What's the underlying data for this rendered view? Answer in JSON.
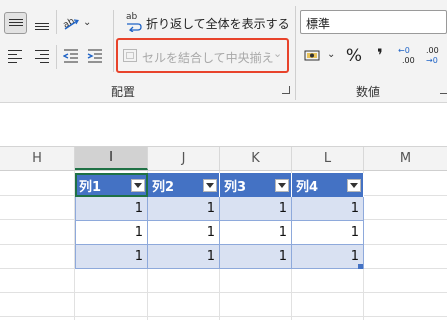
{
  "ribbon": {
    "wrap_text_label": "折り返して全体を表示する",
    "merge_center_label": "セルを結合して中央揃え",
    "merge_center_arrow": "⌄",
    "group_alignment_label": "配置",
    "number_format_value": "標準",
    "group_number_label": "数値",
    "percent_symbol": "%",
    "comma_symbol": "❜",
    "dec_increase_top": "←0",
    "dec_increase_bottom": ".00",
    "dec_decrease_top": ".00",
    "dec_decrease_bottom": "→0",
    "wrap_icon_text": "ab",
    "highlight_color": "#e8432b"
  },
  "columns": [
    "H",
    "I",
    "J",
    "K",
    "L",
    "M"
  ],
  "active_column": "I",
  "table": {
    "headers": [
      "列1",
      "列2",
      "列3",
      "列4"
    ],
    "rows": [
      [
        "1",
        "1",
        "1",
        "1"
      ],
      [
        "1",
        "1",
        "1",
        "1"
      ],
      [
        "1",
        "1",
        "1",
        "1"
      ]
    ],
    "header_color": "#4472c4",
    "band_color": "#d9e1f2"
  }
}
